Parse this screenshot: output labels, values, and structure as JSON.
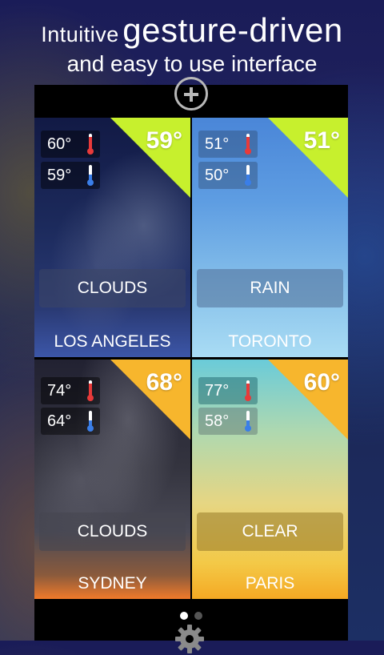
{
  "promo": {
    "line1_small": "Intuitive",
    "line1_big": "gesture-driven",
    "line2": "and easy to use interface"
  },
  "toolbar": {
    "add_icon": "plus-circle-icon",
    "settings_icon": "gear-icon"
  },
  "colors": {
    "corner_green": "#c7f02d",
    "corner_orange": "#f7b62d",
    "thermo_hot": "#e83a3a",
    "thermo_cold": "#3a7ee8"
  },
  "cities": [
    {
      "name": "LOS ANGELES",
      "current": "59°",
      "high": "60°",
      "low": "59°",
      "condition": "CLOUDS"
    },
    {
      "name": "TORONTO",
      "current": "51°",
      "high": "51°",
      "low": "50°",
      "condition": "RAIN"
    },
    {
      "name": "SYDNEY",
      "current": "68°",
      "high": "74°",
      "low": "64°",
      "condition": "CLOUDS"
    },
    {
      "name": "PARIS",
      "current": "60°",
      "high": "77°",
      "low": "58°",
      "condition": "CLEAR"
    }
  ],
  "pager": {
    "pages": 2,
    "active_page": 1
  }
}
